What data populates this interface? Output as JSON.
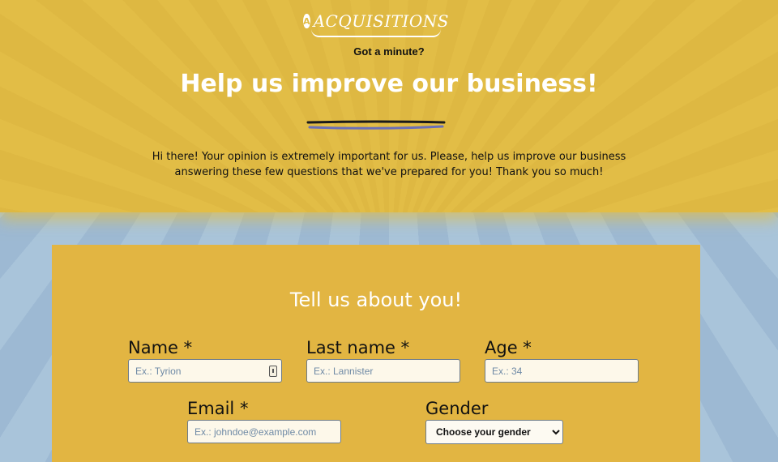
{
  "header": {
    "logo_text": "ACQUISITIONS",
    "logo_mark": "A",
    "tagline": "Got a minute?",
    "headline": "Help us improve our business!",
    "intro": "Hi there! Your opinion is extremely important for us. Please, help us improve our business answering these few questions that we've prepared for you! Thank you so much!"
  },
  "form": {
    "title": "Tell us about you!",
    "fields": {
      "name": {
        "label": "Name *",
        "placeholder": "Ex.: Tyrion",
        "value": ""
      },
      "last_name": {
        "label": "Last name *",
        "placeholder": "Ex.: Lannister",
        "value": ""
      },
      "age": {
        "label": "Age *",
        "placeholder": "Ex.: 34",
        "value": ""
      },
      "email": {
        "label": "Email *",
        "placeholder": "Ex.: johndoe@example.com",
        "value": ""
      },
      "gender": {
        "label": "Gender",
        "selected": "Choose your gender"
      }
    }
  },
  "icons": {
    "logo": "a-circle-icon",
    "autofill": "key-icon"
  },
  "colors": {
    "hero_bg": "#e2bd46",
    "card_bg": "#e2b542",
    "sky": "#a9c4da",
    "divider_dark": "#1a1a1a",
    "divider_blue": "#6a6fb8"
  }
}
